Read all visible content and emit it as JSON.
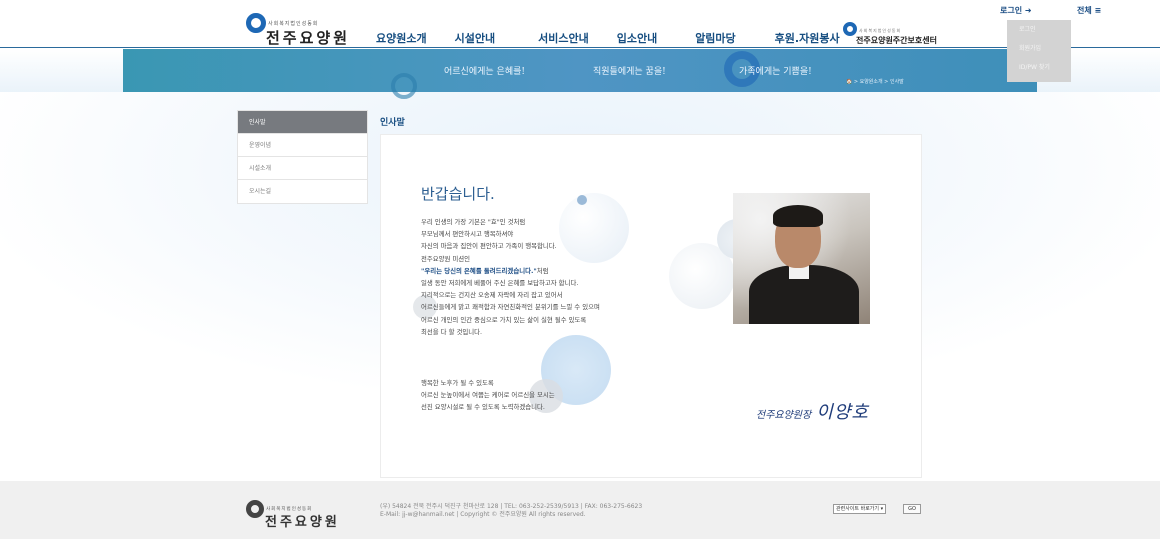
{
  "header": {
    "logo_sub": "사회복지법인성동회",
    "logo_main": "전주요양원",
    "nav": [
      "요양원소개",
      "시설안내",
      "서비스안내",
      "입소안내",
      "알림마당",
      "후원.자원봉사"
    ],
    "partner_sub": "사회복지법인성동회",
    "partner_main": "전주요양원주간보호센터",
    "login_label": "로그인 ➜",
    "all_label": "전체 ≡",
    "dropdown": [
      "로그인",
      "회원가입",
      "ID/PW 찾기"
    ]
  },
  "visual": {
    "slogans": [
      "어르신에게는 은혜를!",
      "직원들에게는 꿈을!",
      "가족에게는 기쁨을!"
    ],
    "breadcrumb": "🏠 > 요양원소개 > 인사말"
  },
  "lnb": {
    "items": [
      "인사말",
      "운영이념",
      "시설소개",
      "오시는길"
    ]
  },
  "content": {
    "title": "인사말",
    "greeting": "반갑습니다.",
    "paragraph1": [
      "우리 인생의 가장 기본은 \"효\"인 것처럼",
      "부모님께서 편안하시고 행복하셔야",
      "자신의 마음과 집안이 편안하고 가족이 행복합니다.",
      "전주요양원 미션인"
    ],
    "mission": "\"우리는 당신의 은혜를 돌려드리겠습니다.\"",
    "mission_tail": "처럼",
    "paragraph2": [
      "일생 동안 저희에게 베풀어 주신 은혜를 보답하고자 합니다.",
      "지리적으로는 건지산 오송제 자락에 자리 잡고 있어서",
      "어르신들에게 맑고 쾌적함과 자연친화적인 분위기를 느낄 수 있으며",
      "어르신 개인의 인간 중심으로 가치 있는 삶이 실현 될수 있도록",
      "최선을 다 할 것입니다."
    ],
    "paragraph3": [
      "행복한 노후가 될 수 있도록",
      "어르신 눈높이에서 여쭙는 케어로 어르신을 모시는",
      "선진 요양시설로 될 수 있도록 노력하겠습니다."
    ],
    "signature_title": "전주요양원장",
    "signature_name": "이양호"
  },
  "footer": {
    "logo_sub": "사회복지법인성동회",
    "logo_main": "전주요양원",
    "address": "(우) 54824 전북 전주시 덕진구 천마산로 128 | TEL: 063-252-2539/5913 | FAX: 063-275-6623",
    "contact": "E-Mail: jj-w@hanmail.net | Copyright © 전주요양원 All rights reserved.",
    "related_site": "관련사이트 바로가기 ▾",
    "go": "GO"
  },
  "colors": {
    "brand": "#1e68b5",
    "nav_text": "#154d80",
    "active_menu": "#777a7f",
    "footer_bg": "#f0f0f0"
  }
}
